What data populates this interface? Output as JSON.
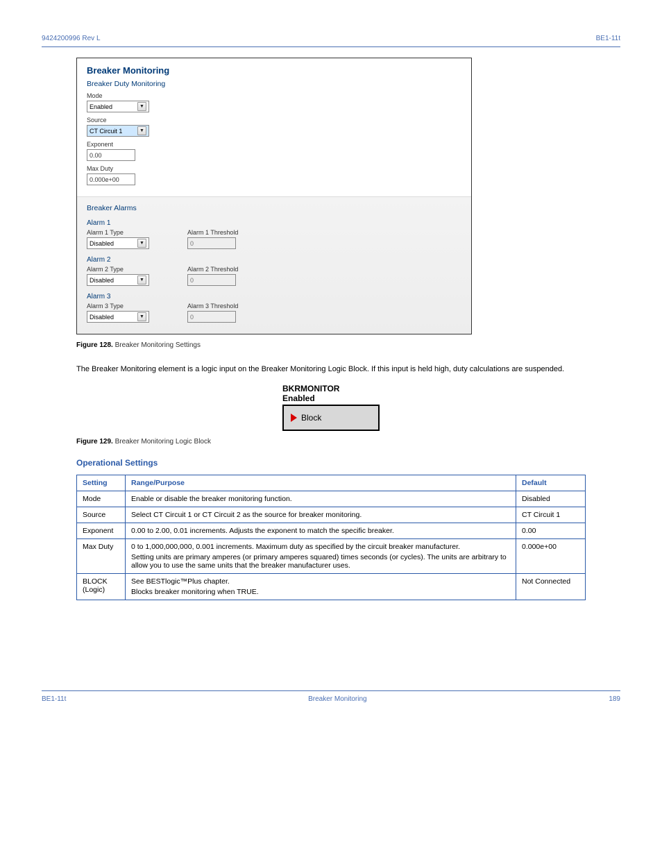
{
  "header": {
    "doc_id": "9424200996 Rev L",
    "page_ref": "BE1-11t",
    "section_title": "Breaker Monitoring"
  },
  "ui": {
    "title": "Breaker Monitoring",
    "duty_title": "Breaker Duty Monitoring",
    "mode_label": "Mode",
    "mode_value": "Enabled",
    "source_label": "Source",
    "source_value": "CT Circuit 1",
    "exponent_label": "Exponent",
    "exponent_value": "0.00",
    "maxduty_label": "Max Duty",
    "maxduty_value": "0.000e+00",
    "alarms_title": "Breaker Alarms",
    "alarm1": {
      "group": "Alarm 1",
      "type_label": "Alarm 1 Type",
      "type_value": "Disabled",
      "thr_label": "Alarm 1 Threshold",
      "thr_value": "0"
    },
    "alarm2": {
      "group": "Alarm 2",
      "type_label": "Alarm 2 Type",
      "type_value": "Disabled",
      "thr_label": "Alarm 2 Threshold",
      "thr_value": "0"
    },
    "alarm3": {
      "group": "Alarm 3",
      "type_label": "Alarm 3 Type",
      "type_value": "Disabled",
      "thr_label": "Alarm 3 Threshold",
      "thr_value": "0"
    }
  },
  "fig128": {
    "num": "Figure 128.",
    "caption": "Breaker Monitoring Settings"
  },
  "para1": "The Breaker Monitoring element is a logic input on the Breaker Monitoring Logic Block. If this input is held high, duty calculations are suspended.",
  "logic": {
    "title": "BKRMONITOR",
    "subtitle": "Enabled",
    "block_label": "Block"
  },
  "fig129": {
    "num": "Figure 129.",
    "caption": "Breaker Monitoring Logic Block"
  },
  "h4": "Operational Settings",
  "table": {
    "headers": {
      "setting": "Setting",
      "desc": "Range/Purpose",
      "default": "Default"
    },
    "rows": [
      {
        "setting": "Mode",
        "desc": "Enable or disable the breaker monitoring function.",
        "default": "Disabled"
      },
      {
        "setting": "Source",
        "desc": "Select CT Circuit 1 or CT Circuit 2 as the source for breaker monitoring.",
        "default": "CT Circuit 1"
      },
      {
        "setting": "Exponent",
        "desc": "0.00 to 2.00, 0.01 increments. Adjusts the exponent to match the specific breaker.",
        "default": "0.00"
      },
      {
        "setting": "Max Duty",
        "desc_lines": [
          "0 to 1,000,000,000, 0.001 increments. Maximum duty as specified by the circuit breaker manufacturer.",
          "Setting units are primary amperes (or primary amperes squared) times seconds (or cycles). The units are arbitrary to allow you to use the same units that the breaker manufacturer uses."
        ],
        "default": "0.000e+00"
      },
      {
        "setting": "BLOCK (Logic)",
        "desc_lines": [
          "See BESTlogic™Plus chapter.",
          "Blocks breaker monitoring when TRUE."
        ],
        "default": "Not Connected"
      }
    ]
  },
  "footer": {
    "left": "BE1-11t",
    "center": "Breaker Monitoring",
    "right": "189"
  }
}
